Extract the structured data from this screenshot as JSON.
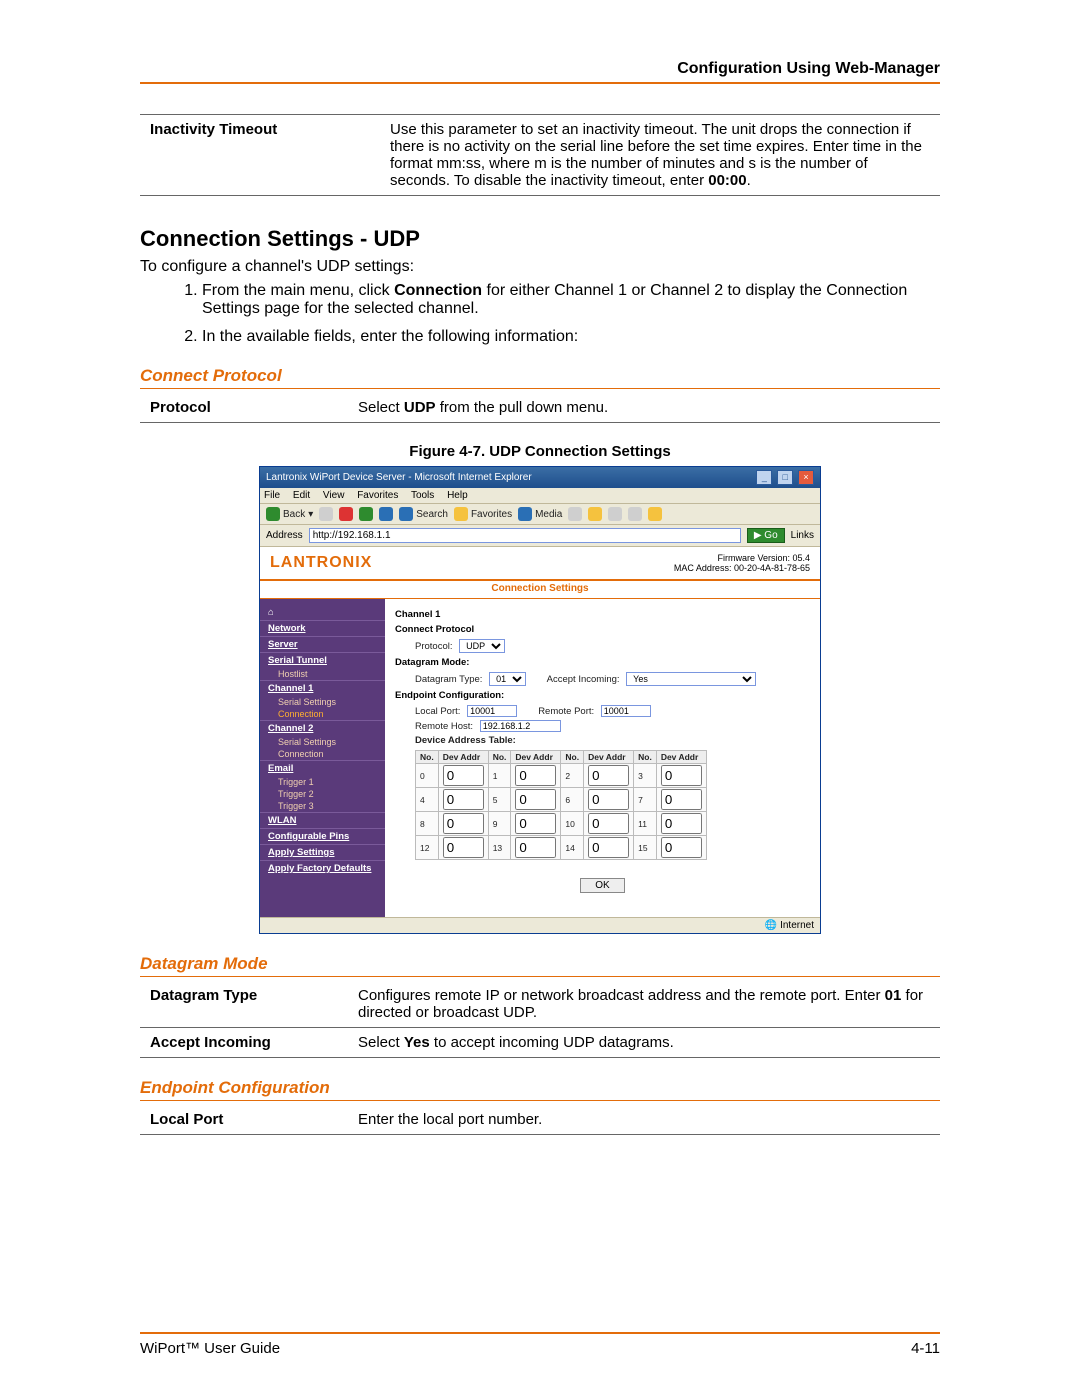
{
  "header": "Configuration Using Web-Manager",
  "intro_table": {
    "label": "Inactivity Timeout",
    "desc_pre": "Use this parameter to set an inactivity timeout. The unit drops the connection if there is no activity on the serial line before the set time expires. Enter time in the format mm:ss, where m is the number of minutes and s is the number of seconds. To disable the inactivity timeout, enter ",
    "desc_bold": "00:00",
    "desc_post": "."
  },
  "heading2": "Connection Settings - UDP",
  "intro1": "To configure a channel's UDP settings:",
  "step1_pre": "From the main menu, click ",
  "step1_bold": "Connection",
  "step1_post": " for either Channel 1 or Channel 2 to display the Connection Settings page for the selected channel.",
  "step2": "In the available fields, enter the following information:",
  "section_connect": "Connect Protocol",
  "proto_label": "Protocol",
  "proto_desc_pre": "Select ",
  "proto_desc_bold": "UDP",
  "proto_desc_post": " from the pull down menu.",
  "figure_caption": "Figure 4-7. UDP Connection Settings",
  "ie": {
    "title": "Lantronix WiPort Device Server - Microsoft Internet Explorer",
    "menus": [
      "File",
      "Edit",
      "View",
      "Favorites",
      "Tools",
      "Help"
    ],
    "back": "Back",
    "search": "Search",
    "favorites": "Favorites",
    "media": "Media",
    "addr_label": "Address",
    "addr_value": "http://192.168.1.1",
    "go": "Go",
    "links": "Links",
    "logo": "LANTRONIX",
    "fw1": "Firmware Version: 05.4",
    "fw2": "MAC Address: 00-20-4A-81-78-65",
    "page_title": "Connection Settings",
    "sidebar": {
      "groups": [
        {
          "label": "Network",
          "items": []
        },
        {
          "label": "Server",
          "items": []
        },
        {
          "label": "Serial Tunnel",
          "items": [
            "Hostlist"
          ]
        },
        {
          "label": "Channel 1",
          "items": [
            "Serial Settings",
            "Connection"
          ]
        },
        {
          "label": "Channel 2",
          "items": [
            "Serial Settings",
            "Connection"
          ]
        },
        {
          "label": "Email",
          "items": [
            "Trigger 1",
            "Trigger 2",
            "Trigger 3"
          ]
        },
        {
          "label": "WLAN",
          "items": []
        },
        {
          "label": "Configurable Pins",
          "items": []
        },
        {
          "label": "Apply Settings",
          "items": []
        },
        {
          "label": "Apply Factory Defaults",
          "items": []
        }
      ],
      "hot": "Connection"
    },
    "form": {
      "channel_title": "Channel 1",
      "cp_title": "Connect Protocol",
      "protocol_label": "Protocol:",
      "protocol_value": "UDP",
      "dm_title": "Datagram Mode:",
      "dtype_label": "Datagram Type:",
      "dtype_value": "01",
      "accept_label": "Accept Incoming:",
      "accept_value": "Yes",
      "ep_title": "Endpoint Configuration:",
      "local_port_label": "Local Port:",
      "local_port_value": "10001",
      "remote_port_label": "Remote Port:",
      "remote_port_value": "10001",
      "remote_host_label": "Remote Host:",
      "remote_host_value": "192.168.1.2",
      "dev_table_title": "Device Address Table:",
      "dev_headers": [
        "No.",
        "Dev Addr"
      ],
      "dev_rows": [
        [
          "0",
          "0",
          "1",
          "0",
          "2",
          "0",
          "3",
          "0"
        ],
        [
          "4",
          "0",
          "5",
          "0",
          "6",
          "0",
          "7",
          "0"
        ],
        [
          "8",
          "0",
          "9",
          "0",
          "10",
          "0",
          "11",
          "0"
        ],
        [
          "12",
          "0",
          "13",
          "0",
          "14",
          "0",
          "15",
          "0"
        ]
      ],
      "ok": "OK"
    },
    "status_right": "Internet"
  },
  "section_datagram": "Datagram Mode",
  "dg_type_label": "Datagram Type",
  "dg_type_desc_pre": "Configures remote IP or network broadcast address and the remote port.  Enter ",
  "dg_type_desc_bold": "01",
  "dg_type_desc_post": " for directed or broadcast UDP.",
  "dg_acc_label": "Accept Incoming",
  "dg_acc_desc_pre": "Select ",
  "dg_acc_desc_bold": "Yes",
  "dg_acc_desc_post": " to accept incoming UDP datagrams.",
  "section_endpoint": "Endpoint Configuration",
  "ep_local_label": "Local Port",
  "ep_local_desc": "Enter the local port number.",
  "footer_left": "WiPort™ User Guide",
  "footer_right": "4-11"
}
